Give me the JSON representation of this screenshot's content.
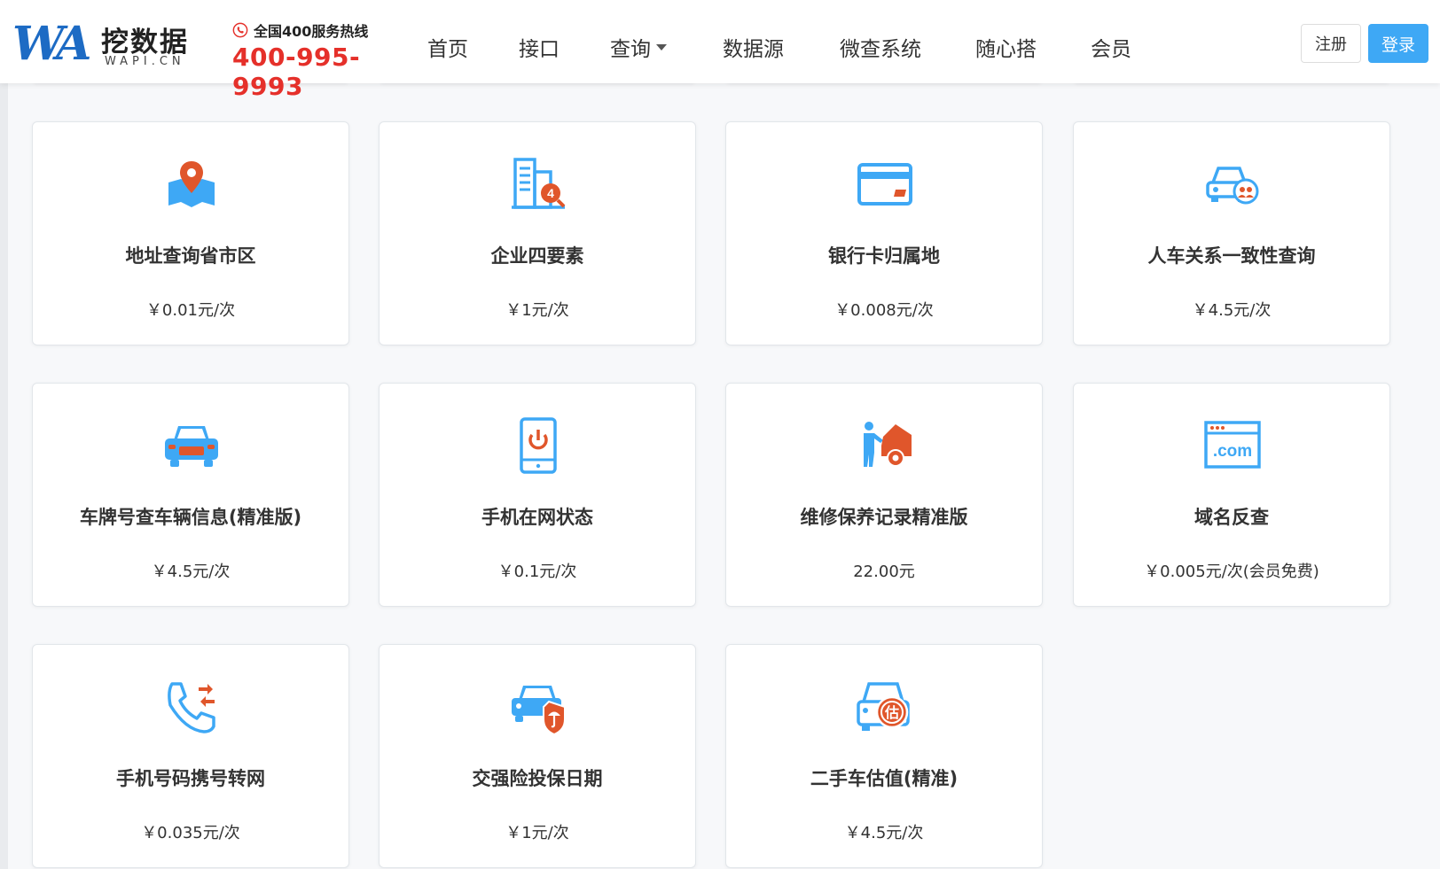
{
  "header": {
    "logo_mark": "WA",
    "logo_cn": "挖数据",
    "logo_en": "WAPI.CN",
    "hotline_label": "全国400服务热线",
    "hotline_number": "400-995-9993",
    "nav": [
      "首页",
      "接口",
      "查询",
      "数据源",
      "微查系统",
      "随心搭",
      "会员"
    ],
    "register": "注册",
    "login": "登录"
  },
  "products": [
    {
      "title": "地址查询省市区",
      "price": "￥0.01元/次",
      "icon": "map-pin-icon"
    },
    {
      "title": "企业四要素",
      "price": "￥1元/次",
      "icon": "company-search-icon"
    },
    {
      "title": "银行卡归属地",
      "price": "￥0.008元/次",
      "icon": "bank-card-icon"
    },
    {
      "title": "人车关系一致性查询",
      "price": "￥4.5元/次",
      "icon": "car-people-icon"
    },
    {
      "title": "车牌号查车辆信息(精准版)",
      "price": "￥4.5元/次",
      "icon": "license-plate-car-icon"
    },
    {
      "title": "手机在网状态",
      "price": "￥0.1元/次",
      "icon": "mobile-power-icon"
    },
    {
      "title": "维修保养记录精准版",
      "price": "22.00元",
      "icon": "car-repair-icon"
    },
    {
      "title": "域名反查",
      "price": "￥0.005元/次(会员免费)",
      "icon": "domain-com-icon"
    },
    {
      "title": "手机号码携号转网",
      "price": "￥0.035元/次",
      "icon": "phone-transfer-icon"
    },
    {
      "title": "交强险投保日期",
      "price": "￥1元/次",
      "icon": "car-insurance-icon"
    },
    {
      "title": "二手车估值(精准)",
      "price": "￥4.5元/次",
      "icon": "used-car-value-icon"
    }
  ],
  "colors": {
    "blue": "#3ea8f5",
    "orange": "#e0562b",
    "red": "#e5302a"
  }
}
